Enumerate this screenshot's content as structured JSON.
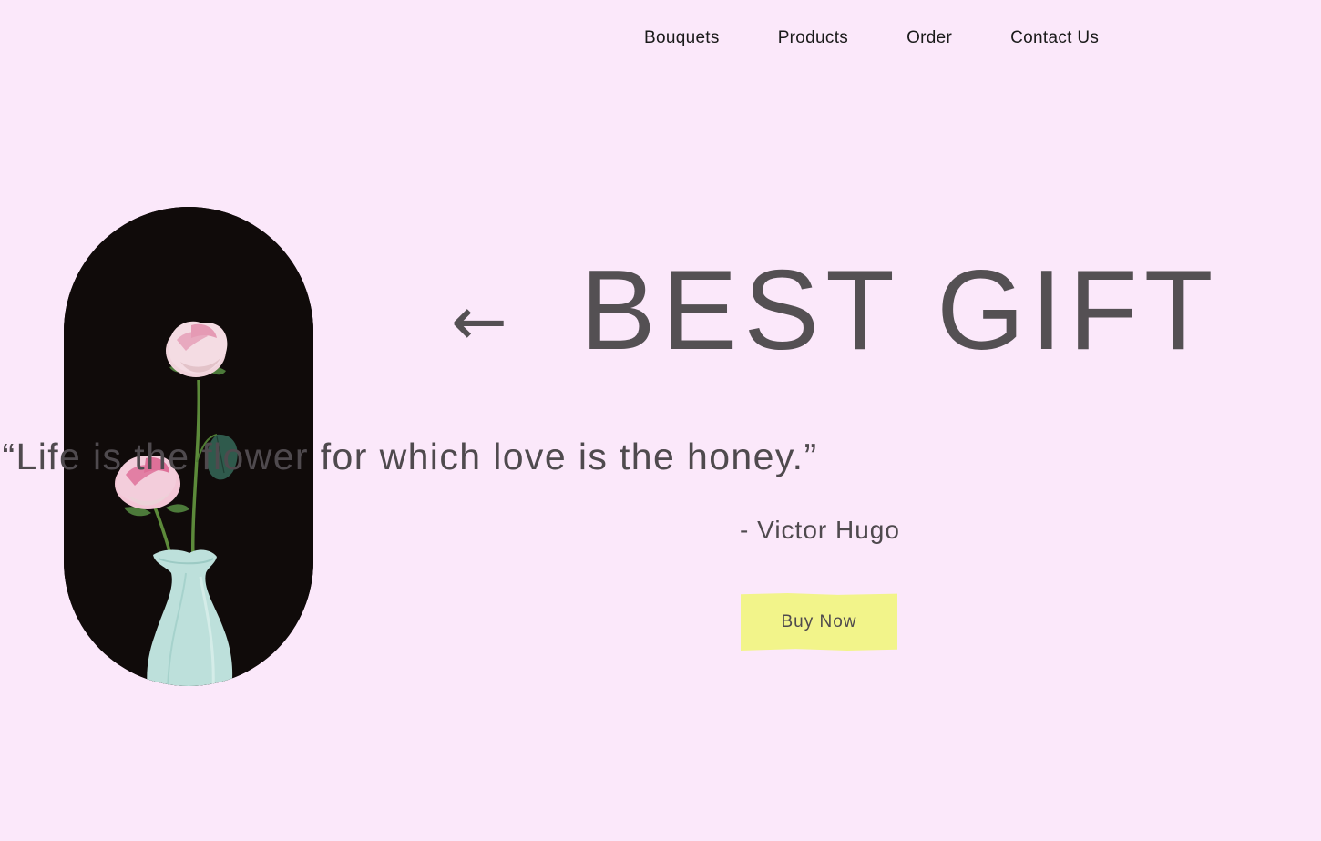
{
  "nav": {
    "items": [
      {
        "label": "Bouquets"
      },
      {
        "label": "Products"
      },
      {
        "label": "Order"
      },
      {
        "label": "Contact Us"
      }
    ]
  },
  "hero": {
    "arrow_glyph": "←",
    "title": "BEST GIFT",
    "quote": "“Life is the flower for which love is the honey.”",
    "author": "- Victor Hugo",
    "buy_label": "Buy Now"
  },
  "image": {
    "subject": "rose-vase-photo"
  },
  "colors": {
    "background": "#fbe8fa",
    "text": "#545053",
    "button": "#f2f48a",
    "image_background": "#100b0a"
  }
}
